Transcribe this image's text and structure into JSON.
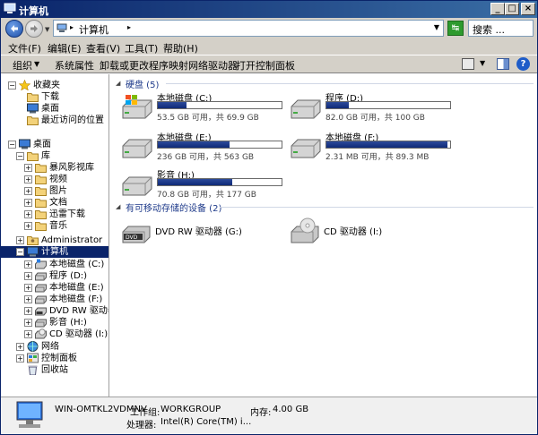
{
  "window": {
    "title": "计算机"
  },
  "address": {
    "path": "计算机"
  },
  "search": {
    "placeholder": "搜索 ..."
  },
  "menu": [
    "文件(F)",
    "编辑(E)",
    "查看(V)",
    "工具(T)",
    "帮助(H)"
  ],
  "toolbar": [
    "组织",
    "系统属性",
    "卸载或更改程序",
    "映射网络驱动器",
    "打开控制面板"
  ],
  "nav": [
    {
      "label": "收藏夹",
      "icon": "star-icon"
    },
    {
      "label": "下载",
      "icon": "download-folder-icon"
    },
    {
      "label": "桌面",
      "icon": "desktop-icon"
    },
    {
      "label": "最近访问的位置",
      "icon": "recent-places-icon"
    },
    {
      "label": "桌面",
      "icon": "desktop-icon"
    },
    {
      "label": "库",
      "icon": "library-icon"
    },
    {
      "label": "暴风影视库",
      "icon": "video-library-icon"
    },
    {
      "label": "视频",
      "icon": "video-icon"
    },
    {
      "label": "图片",
      "icon": "picture-icon"
    },
    {
      "label": "文档",
      "icon": "document-icon"
    },
    {
      "label": "迅雷下载",
      "icon": "download-icon"
    },
    {
      "label": "音乐",
      "icon": "music-icon"
    },
    {
      "label": "Administrator",
      "icon": "user-folder-icon"
    },
    {
      "label": "计算机",
      "icon": "computer-icon"
    },
    {
      "label": "本地磁盘 (C:)",
      "icon": "system-drive-icon"
    },
    {
      "label": "程序 (D:)",
      "icon": "drive-icon"
    },
    {
      "label": "本地磁盘 (E:)",
      "icon": "drive-icon"
    },
    {
      "label": "本地磁盘 (F:)",
      "icon": "drive-icon"
    },
    {
      "label": "DVD RW 驱动器 (G",
      "icon": "dvd-drive-icon"
    },
    {
      "label": "影音 (H:)",
      "icon": "drive-icon"
    },
    {
      "label": "CD 驱动器 (I:)",
      "icon": "cd-drive-icon"
    },
    {
      "label": "网络",
      "icon": "network-icon"
    },
    {
      "label": "控制面板",
      "icon": "control-panel-icon"
    },
    {
      "label": "回收站",
      "icon": "recycle-bin-icon"
    }
  ],
  "groups": {
    "hdd": "硬盘 (5)",
    "removable": "有可移动存储的设备 (2)"
  },
  "drives": [
    {
      "name": "本地磁盘 (C:)",
      "info": "53.5 GB 可用，共 69.9 GB",
      "used": 0.235
    },
    {
      "name": "程序 (D:)",
      "info": "82.0 GB 可用，共 100 GB",
      "used": 0.18
    },
    {
      "name": "本地磁盘 (E:)",
      "info": "236 GB 可用，共 563 GB",
      "used": 0.58
    },
    {
      "name": "本地磁盘 (F:)",
      "info": "2.31 MB 可用，共 89.3 MB",
      "used": 0.975
    },
    {
      "name": "影音 (H:)",
      "info": "70.8 GB 可用，共 177 GB",
      "used": 0.6
    }
  ],
  "devices": [
    {
      "name": "DVD RW 驱动器 (G:)"
    },
    {
      "name": "CD 驱动器 (I:)"
    }
  ],
  "details": {
    "name": "WIN-OMTKL2VDMNV",
    "wg_label": "工作组:",
    "workgroup": "WORKGROUP",
    "mem_label": "内存:",
    "memory": "4.00 GB",
    "cpu_label": "处理器:",
    "cpu": "Intel(R) Core(TM) i..."
  }
}
